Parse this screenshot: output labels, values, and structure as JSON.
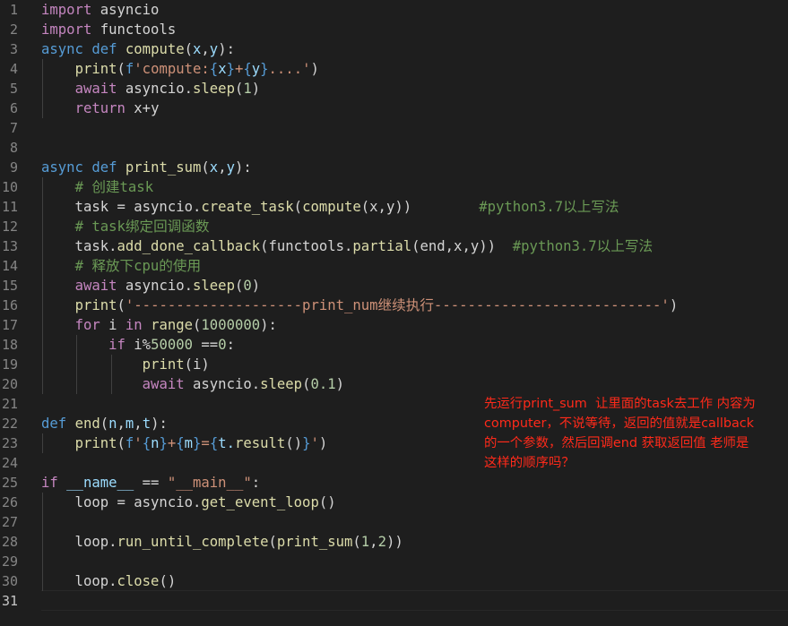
{
  "editor": {
    "line_numbers": [
      "1",
      "2",
      "3",
      "4",
      "5",
      "6",
      "7",
      "8",
      "9",
      "10",
      "11",
      "12",
      "13",
      "14",
      "15",
      "16",
      "17",
      "18",
      "19",
      "20",
      "21",
      "22",
      "23",
      "24",
      "25",
      "26",
      "27",
      "28",
      "29",
      "30",
      "31"
    ],
    "active_line": "31",
    "lines": [
      [
        {
          "t": "import",
          "c": "ctl"
        },
        {
          "t": " asyncio",
          "c": "txt"
        }
      ],
      [
        {
          "t": "import",
          "c": "ctl"
        },
        {
          "t": " functools",
          "c": "txt"
        }
      ],
      [
        {
          "t": "async",
          "c": "kw"
        },
        {
          "t": " ",
          "c": "txt"
        },
        {
          "t": "def",
          "c": "kw"
        },
        {
          "t": " ",
          "c": "txt"
        },
        {
          "t": "compute",
          "c": "fn"
        },
        {
          "t": "(",
          "c": "txt"
        },
        {
          "t": "x",
          "c": "var"
        },
        {
          "t": ",",
          "c": "txt"
        },
        {
          "t": "y",
          "c": "var"
        },
        {
          "t": "):",
          "c": "txt"
        }
      ],
      [
        {
          "t": "    ",
          "c": "txt"
        },
        {
          "t": "print",
          "c": "fn"
        },
        {
          "t": "(",
          "c": "txt"
        },
        {
          "t": "f",
          "c": "kw"
        },
        {
          "t": "'compute:",
          "c": "str"
        },
        {
          "t": "{",
          "c": "kw"
        },
        {
          "t": "x",
          "c": "var"
        },
        {
          "t": "}",
          "c": "kw"
        },
        {
          "t": "+",
          "c": "str"
        },
        {
          "t": "{",
          "c": "kw"
        },
        {
          "t": "y",
          "c": "var"
        },
        {
          "t": "}",
          "c": "kw"
        },
        {
          "t": "....'",
          "c": "str"
        },
        {
          "t": ")",
          "c": "txt"
        }
      ],
      [
        {
          "t": "    ",
          "c": "txt"
        },
        {
          "t": "await",
          "c": "ctl"
        },
        {
          "t": " asyncio.",
          "c": "txt"
        },
        {
          "t": "sleep",
          "c": "fn"
        },
        {
          "t": "(",
          "c": "txt"
        },
        {
          "t": "1",
          "c": "num"
        },
        {
          "t": ")",
          "c": "txt"
        }
      ],
      [
        {
          "t": "    ",
          "c": "txt"
        },
        {
          "t": "return",
          "c": "ctl"
        },
        {
          "t": " x+y",
          "c": "txt"
        }
      ],
      [],
      [],
      [
        {
          "t": "async",
          "c": "kw"
        },
        {
          "t": " ",
          "c": "txt"
        },
        {
          "t": "def",
          "c": "kw"
        },
        {
          "t": " ",
          "c": "txt"
        },
        {
          "t": "print_sum",
          "c": "fn"
        },
        {
          "t": "(",
          "c": "txt"
        },
        {
          "t": "x",
          "c": "var"
        },
        {
          "t": ",",
          "c": "txt"
        },
        {
          "t": "y",
          "c": "var"
        },
        {
          "t": "):",
          "c": "txt"
        }
      ],
      [
        {
          "t": "    ",
          "c": "txt"
        },
        {
          "t": "# 创建task",
          "c": "cmt"
        }
      ],
      [
        {
          "t": "    task = asyncio.",
          "c": "txt"
        },
        {
          "t": "create_task",
          "c": "fn"
        },
        {
          "t": "(",
          "c": "txt"
        },
        {
          "t": "compute",
          "c": "fn"
        },
        {
          "t": "(x,y))        ",
          "c": "txt"
        },
        {
          "t": "#python3.7以上写法",
          "c": "cmt"
        }
      ],
      [
        {
          "t": "    ",
          "c": "txt"
        },
        {
          "t": "# task绑定回调函数",
          "c": "cmt"
        }
      ],
      [
        {
          "t": "    task.",
          "c": "txt"
        },
        {
          "t": "add_done_callback",
          "c": "fn"
        },
        {
          "t": "(functools.",
          "c": "txt"
        },
        {
          "t": "partial",
          "c": "fn"
        },
        {
          "t": "(end,x,y))  ",
          "c": "txt"
        },
        {
          "t": "#python3.7以上写法",
          "c": "cmt"
        }
      ],
      [
        {
          "t": "    ",
          "c": "txt"
        },
        {
          "t": "# 释放下cpu的使用",
          "c": "cmt"
        }
      ],
      [
        {
          "t": "    ",
          "c": "txt"
        },
        {
          "t": "await",
          "c": "ctl"
        },
        {
          "t": " asyncio.",
          "c": "txt"
        },
        {
          "t": "sleep",
          "c": "fn"
        },
        {
          "t": "(",
          "c": "txt"
        },
        {
          "t": "0",
          "c": "num"
        },
        {
          "t": ")",
          "c": "txt"
        }
      ],
      [
        {
          "t": "    ",
          "c": "txt"
        },
        {
          "t": "print",
          "c": "fn"
        },
        {
          "t": "(",
          "c": "txt"
        },
        {
          "t": "'--------------------print_num继续执行---------------------------'",
          "c": "str"
        },
        {
          "t": ")",
          "c": "txt"
        }
      ],
      [
        {
          "t": "    ",
          "c": "txt"
        },
        {
          "t": "for",
          "c": "ctl"
        },
        {
          "t": " i ",
          "c": "txt"
        },
        {
          "t": "in",
          "c": "ctl"
        },
        {
          "t": " ",
          "c": "txt"
        },
        {
          "t": "range",
          "c": "fn"
        },
        {
          "t": "(",
          "c": "txt"
        },
        {
          "t": "1000000",
          "c": "num"
        },
        {
          "t": "):",
          "c": "txt"
        }
      ],
      [
        {
          "t": "        ",
          "c": "txt"
        },
        {
          "t": "if",
          "c": "ctl"
        },
        {
          "t": " i%",
          "c": "txt"
        },
        {
          "t": "50000",
          "c": "num"
        },
        {
          "t": " ==",
          "c": "txt"
        },
        {
          "t": "0",
          "c": "num"
        },
        {
          "t": ":",
          "c": "txt"
        }
      ],
      [
        {
          "t": "            ",
          "c": "txt"
        },
        {
          "t": "print",
          "c": "fn"
        },
        {
          "t": "(i)",
          "c": "txt"
        }
      ],
      [
        {
          "t": "            ",
          "c": "txt"
        },
        {
          "t": "await",
          "c": "ctl"
        },
        {
          "t": " asyncio.",
          "c": "txt"
        },
        {
          "t": "sleep",
          "c": "fn"
        },
        {
          "t": "(",
          "c": "txt"
        },
        {
          "t": "0.1",
          "c": "num"
        },
        {
          "t": ")",
          "c": "txt"
        }
      ],
      [],
      [
        {
          "t": "def",
          "c": "kw"
        },
        {
          "t": " ",
          "c": "txt"
        },
        {
          "t": "end",
          "c": "fn"
        },
        {
          "t": "(",
          "c": "txt"
        },
        {
          "t": "n",
          "c": "var"
        },
        {
          "t": ",",
          "c": "txt"
        },
        {
          "t": "m",
          "c": "var"
        },
        {
          "t": ",",
          "c": "txt"
        },
        {
          "t": "t",
          "c": "var"
        },
        {
          "t": "):",
          "c": "txt"
        }
      ],
      [
        {
          "t": "    ",
          "c": "txt"
        },
        {
          "t": "print",
          "c": "fn"
        },
        {
          "t": "(",
          "c": "txt"
        },
        {
          "t": "f",
          "c": "kw"
        },
        {
          "t": "'",
          "c": "str"
        },
        {
          "t": "{",
          "c": "kw"
        },
        {
          "t": "n",
          "c": "var"
        },
        {
          "t": "}",
          "c": "kw"
        },
        {
          "t": "+",
          "c": "str"
        },
        {
          "t": "{",
          "c": "kw"
        },
        {
          "t": "m",
          "c": "var"
        },
        {
          "t": "}",
          "c": "kw"
        },
        {
          "t": "=",
          "c": "str"
        },
        {
          "t": "{",
          "c": "kw"
        },
        {
          "t": "t.",
          "c": "var"
        },
        {
          "t": "result",
          "c": "fn"
        },
        {
          "t": "()",
          "c": "txt"
        },
        {
          "t": "}",
          "c": "kw"
        },
        {
          "t": "'",
          "c": "str"
        },
        {
          "t": ")",
          "c": "txt"
        }
      ],
      [],
      [
        {
          "t": "if",
          "c": "ctl"
        },
        {
          "t": " ",
          "c": "txt"
        },
        {
          "t": "__name__",
          "c": "var"
        },
        {
          "t": " == ",
          "c": "txt"
        },
        {
          "t": "\"__main__\"",
          "c": "str"
        },
        {
          "t": ":",
          "c": "txt"
        }
      ],
      [
        {
          "t": "    loop = asyncio.",
          "c": "txt"
        },
        {
          "t": "get_event_loop",
          "c": "fn"
        },
        {
          "t": "()",
          "c": "txt"
        }
      ],
      [],
      [
        {
          "t": "    loop.",
          "c": "txt"
        },
        {
          "t": "run_until_complete",
          "c": "fn"
        },
        {
          "t": "(",
          "c": "txt"
        },
        {
          "t": "print_sum",
          "c": "fn"
        },
        {
          "t": "(",
          "c": "txt"
        },
        {
          "t": "1",
          "c": "num"
        },
        {
          "t": ",",
          "c": "txt"
        },
        {
          "t": "2",
          "c": "num"
        },
        {
          "t": "))",
          "c": "txt"
        }
      ],
      [],
      [
        {
          "t": "    loop.",
          "c": "txt"
        },
        {
          "t": "close",
          "c": "fn"
        },
        {
          "t": "()",
          "c": "txt"
        }
      ],
      []
    ]
  },
  "annotation": {
    "text": "先运行print_sum  让里面的task去工作 内容为\ncomputer，不说等待，返回的值就是callback\n的一个参数，然后回调end 获取返回值 老师是\n这样的顺序吗？"
  },
  "colors": {
    "background": "#1e1e1e",
    "keyword": "#569cd6",
    "control": "#c586c0",
    "function": "#dcdcaa",
    "string": "#ce9178",
    "number": "#b5cea8",
    "comment": "#6a9955",
    "variable": "#9cdcfe",
    "annotation": "#ff2a1a"
  }
}
